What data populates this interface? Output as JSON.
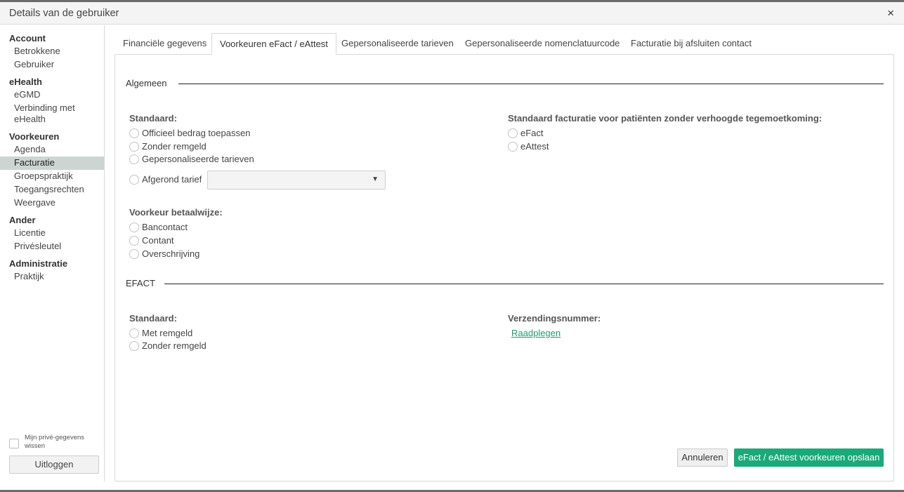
{
  "dialog": {
    "title": "Details van de gebruiker",
    "close_icon": "×"
  },
  "sidebar": {
    "groups": [
      {
        "label": "Account",
        "items": [
          "Betrokkene",
          "Gebruiker"
        ]
      },
      {
        "label": "eHealth",
        "items": [
          "eGMD",
          "Verbinding met eHealth"
        ]
      },
      {
        "label": "Voorkeuren",
        "items": [
          "Agenda",
          "Facturatie",
          "Groepspraktijk",
          "Toegangsrechten",
          "Weergave"
        ]
      },
      {
        "label": "Ander",
        "items": [
          "Licentie",
          "Privésleutel"
        ]
      },
      {
        "label": "Administratie",
        "items": [
          "Praktijk"
        ]
      }
    ],
    "active_item": "Facturatie",
    "privacy_label": "Mijn privé-gegevens wissen",
    "logout_label": "Uitloggen"
  },
  "tabs": [
    {
      "label": "Financiële gegevens",
      "active": false
    },
    {
      "label": "Voorkeuren eFact / eAttest",
      "active": true
    },
    {
      "label": "Gepersonaliseerde tarieven",
      "active": false
    },
    {
      "label": "Gepersonaliseerde nomenclatuurcode",
      "active": false
    },
    {
      "label": "Facturatie bij afsluiten contact",
      "active": false
    }
  ],
  "algemeen": {
    "title": "Algemeen",
    "standaard_label": "Standaard:",
    "standaard_options": [
      "Officieel bedrag toepassen",
      "Zonder remgeld",
      "Gepersonaliseerde tarieven",
      "Afgerond tarief"
    ],
    "afgerond_select_value": "",
    "betaalwijze_label": "Voorkeur betaalwijze:",
    "betaalwijze_options": [
      "Bancontact",
      "Contant",
      "Overschrijving"
    ],
    "facturatie_label": "Standaard facturatie voor patiënten zonder verhoogde tegemoetkoming:",
    "facturatie_options": [
      "eFact",
      "eAttest"
    ]
  },
  "efact": {
    "title": "EFACT",
    "standaard_label": "Standaard:",
    "standaard_options": [
      "Met remgeld",
      "Zonder remgeld"
    ],
    "verzending_label": "Verzendingsnummer:",
    "verzending_link": "Raadplegen"
  },
  "footer": {
    "cancel_label": "Annuleren",
    "save_label": "eFact / eAttest voorkeuren opslaan"
  },
  "colors": {
    "accent": "#1aaa7a",
    "link": "#1a9e72",
    "active_sidebar": "#ccd5d1"
  }
}
